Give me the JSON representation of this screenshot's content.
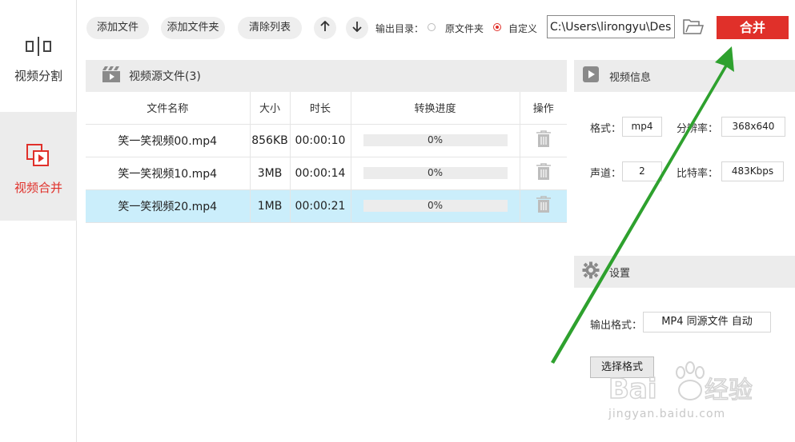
{
  "sidebar": {
    "items": [
      {
        "label": "视频分割",
        "active": false
      },
      {
        "label": "视频合并",
        "active": true
      }
    ]
  },
  "toolbar": {
    "add_file": "添加文件",
    "add_folder": "添加文件夹",
    "clear_list": "清除列表",
    "output_dir_label": "输出目录：",
    "option_source": "原文件夹",
    "option_custom": "自定义",
    "selected_option": "自定义",
    "output_path": "C:\\Users\\lirongyu\\Desk",
    "merge": "合并"
  },
  "source_panel": {
    "title": "视频源文件(3)",
    "columns": [
      "文件名称",
      "大小",
      "时长",
      "转换进度",
      "操作"
    ],
    "rows": [
      {
        "name": "笑一笑视频00.mp4",
        "size": "856KB",
        "duration": "00:00:10",
        "progress": "0%",
        "progress_value": 0,
        "selected": false
      },
      {
        "name": "笑一笑视频10.mp4",
        "size": "3MB",
        "duration": "00:00:14",
        "progress": "0%",
        "progress_value": 0,
        "selected": false
      },
      {
        "name": "笑一笑视频20.mp4",
        "size": "1MB",
        "duration": "00:00:21",
        "progress": "0%",
        "progress_value": 0,
        "selected": true
      }
    ]
  },
  "video_info": {
    "title": "视频信息",
    "format_label": "格式：",
    "format_value": "mp4",
    "resolution_label": "分辨率：",
    "resolution_value": "368x640",
    "channels_label": "声道：",
    "channels_value": "2",
    "bitrate_label": "比特率：",
    "bitrate_value": "483Kbps"
  },
  "settings": {
    "title": "设置",
    "output_format_label": "输出格式：",
    "output_format_value": "MP4 同源文件 自动",
    "choose_format": "选择格式"
  },
  "watermark": {
    "logo": "Baidu经验",
    "url": "jingyan.baidu.com"
  },
  "colors": {
    "accent": "#e0302a",
    "selected_row": "#cbeefb",
    "panel_header": "#ececec",
    "arrow": "#2ea12e"
  },
  "icons": [
    "split-icon",
    "merge-icon",
    "up-arrow-icon",
    "down-arrow-icon",
    "folder-open-icon",
    "film-icon",
    "play-icon",
    "gear-icon",
    "trash-icon"
  ]
}
